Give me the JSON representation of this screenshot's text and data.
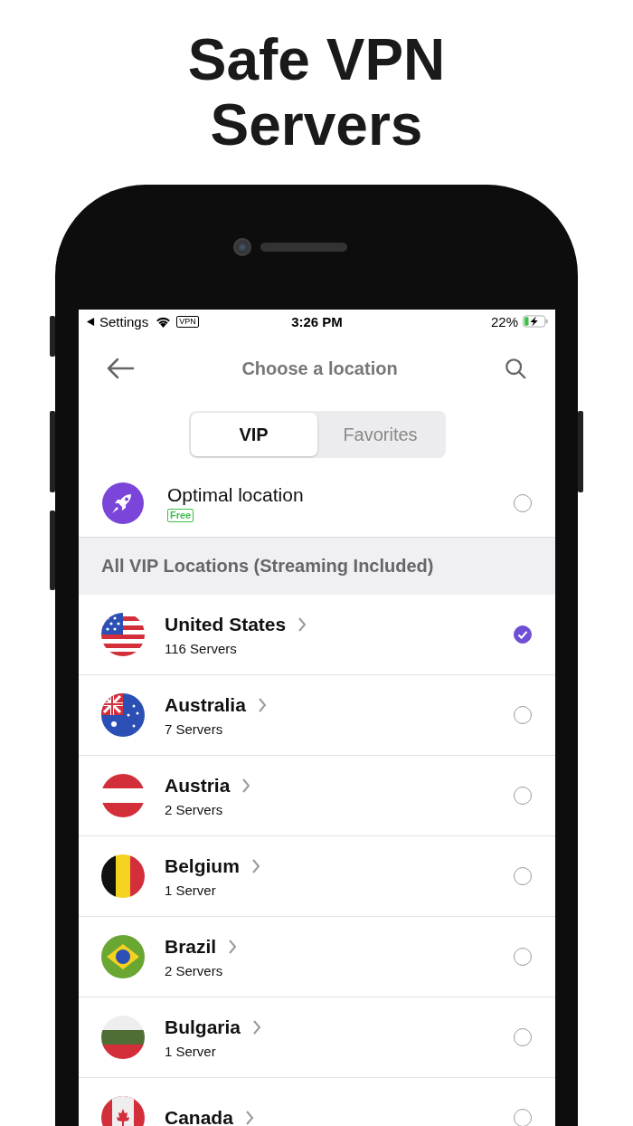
{
  "headline": "Safe VPN Servers",
  "status_bar": {
    "back_label": "Settings",
    "vpn_badge": "VPN",
    "time": "3:26 PM",
    "battery": "22%"
  },
  "nav": {
    "title": "Choose a location"
  },
  "tabs": [
    {
      "label": "VIP",
      "selected": true
    },
    {
      "label": "Favorites",
      "selected": false
    }
  ],
  "optimal": {
    "title": "Optimal location",
    "badge": "Free",
    "selected": false
  },
  "section_header": "All VIP Locations (Streaming Included)",
  "locations": [
    {
      "name": "United States",
      "servers": "116 Servers",
      "selected": true
    },
    {
      "name": "Australia",
      "servers": "7 Servers",
      "selected": false
    },
    {
      "name": "Austria",
      "servers": "2 Servers",
      "selected": false
    },
    {
      "name": "Belgium",
      "servers": "1 Server",
      "selected": false
    },
    {
      "name": "Brazil",
      "servers": "2 Servers",
      "selected": false
    },
    {
      "name": "Bulgaria",
      "servers": "1 Server",
      "selected": false
    },
    {
      "name": "Canada",
      "selected": false
    }
  ]
}
